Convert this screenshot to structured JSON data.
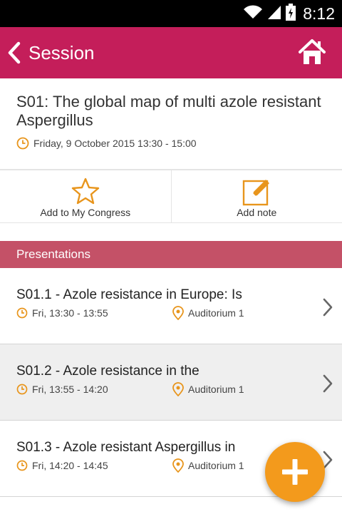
{
  "status_bar": {
    "time": "8:12",
    "icons": [
      "wifi-icon",
      "signal-icon",
      "battery-icon"
    ]
  },
  "app_bar": {
    "title": "Session",
    "back_icon": "chevron-left-icon",
    "home_icon": "home-icon"
  },
  "session": {
    "title": "S01: The global map of multi azole resistant Aspergillus",
    "datetime": "Friday, 9 October 2015 13:30 - 15:00"
  },
  "actions": [
    {
      "label": "Add to My Congress",
      "icon": "star-icon"
    },
    {
      "label": "Add note",
      "icon": "note-edit-icon"
    }
  ],
  "section": {
    "title": "Presentations"
  },
  "presentations": [
    {
      "title": "S01.1 - Azole resistance in Europe: Is",
      "time": "Fri, 13:30 - 13:55",
      "location": "Auditorium 1"
    },
    {
      "title": "S01.2 - Azole resistance in the",
      "time": "Fri, 13:55 - 14:20",
      "location": "Auditorium 1"
    },
    {
      "title": "S01.3 - Azole resistant Aspergillus in",
      "time": "Fri, 14:20 - 14:45",
      "location": "Auditorium 1"
    }
  ],
  "fab": {
    "icon": "plus-icon"
  },
  "colors": {
    "primary": "#c41e5a",
    "section": "#c45167",
    "accent": "#e8951c",
    "fab": "#f39a1c"
  }
}
